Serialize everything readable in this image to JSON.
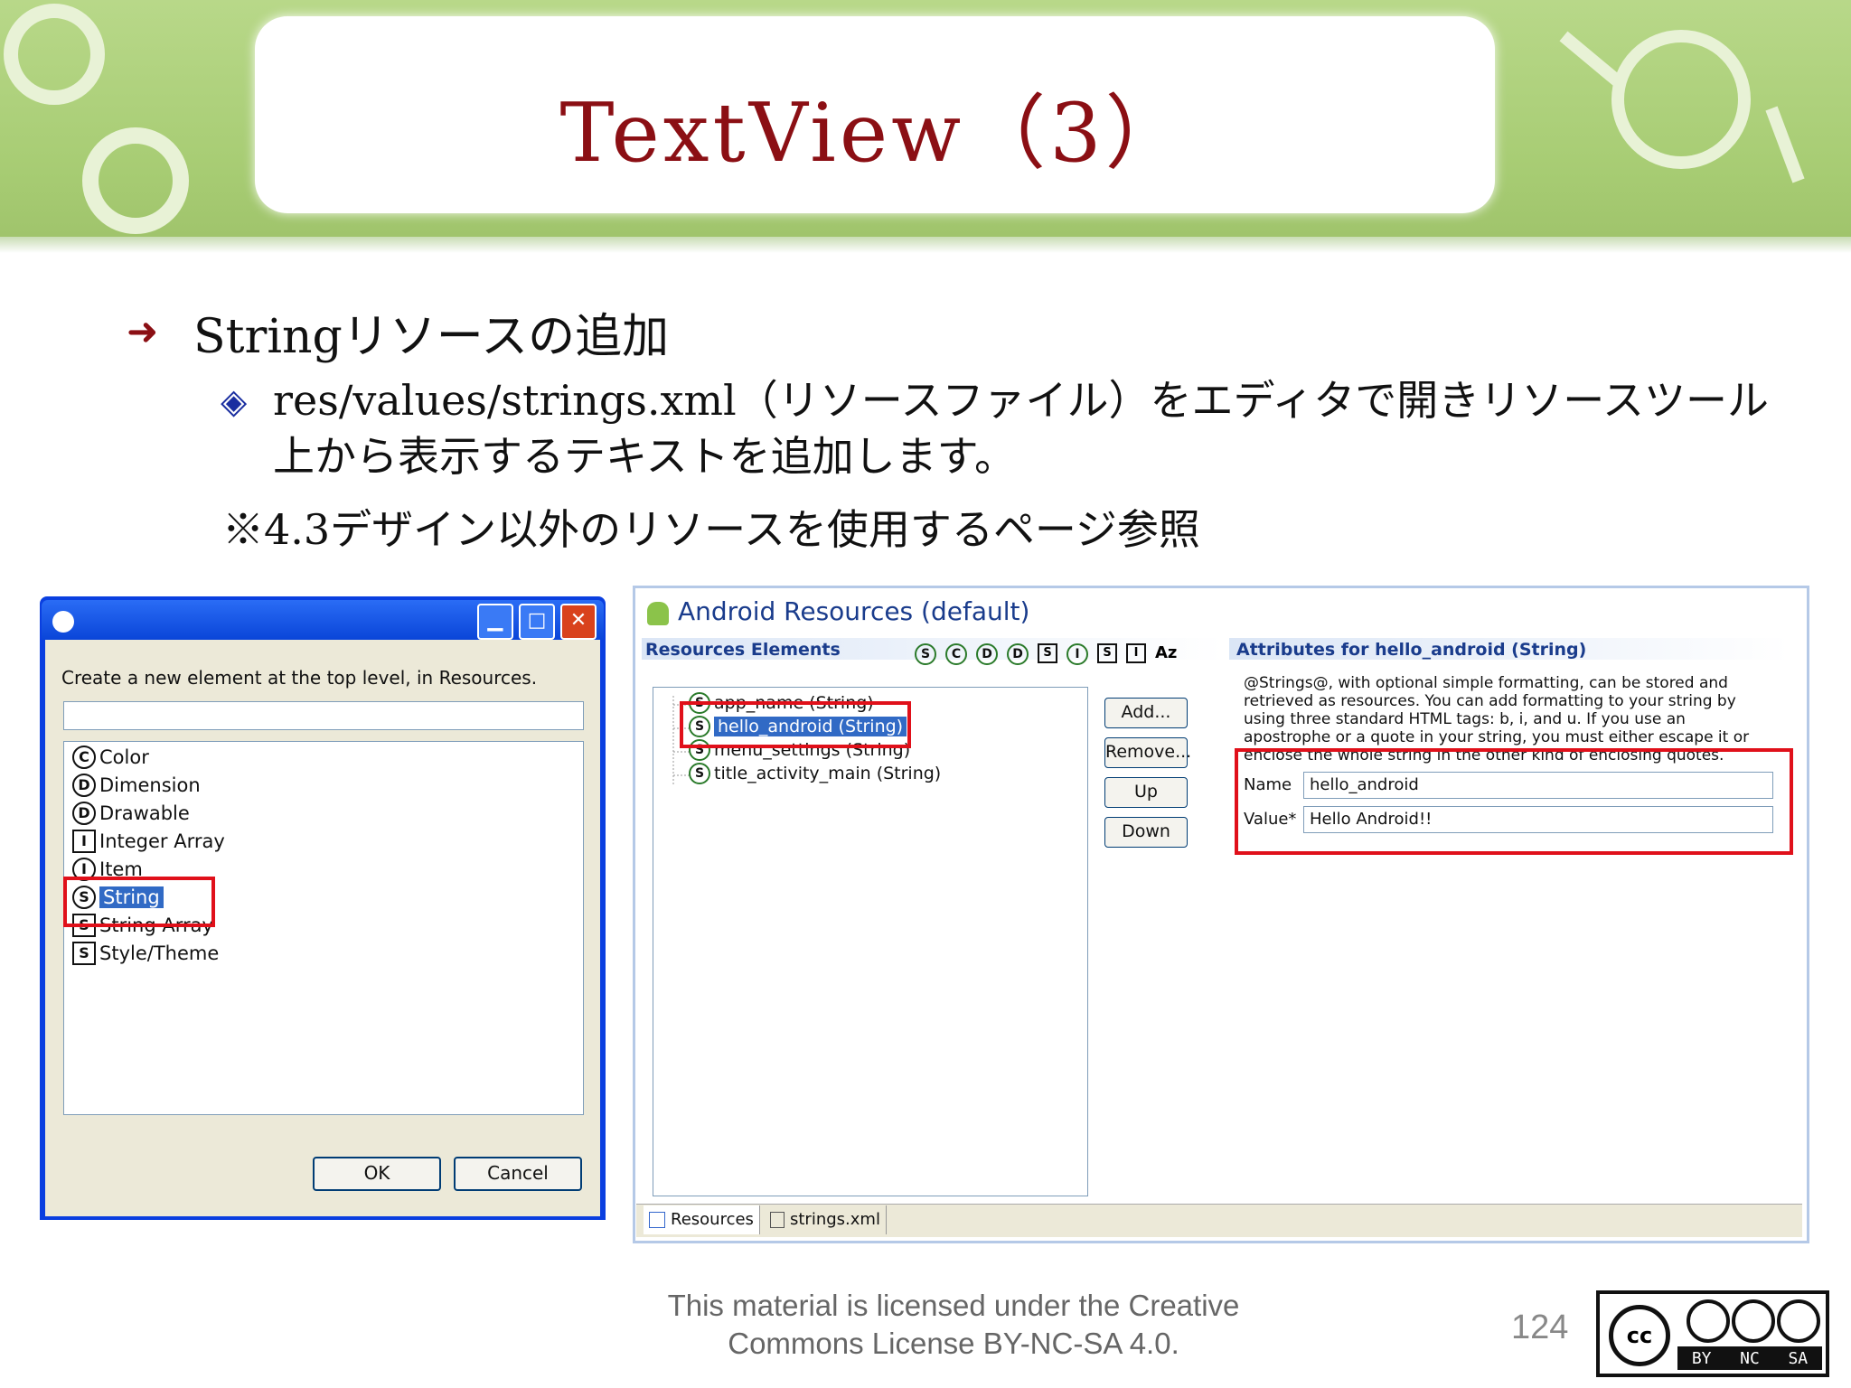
{
  "slide": {
    "title": "TextView（3）",
    "bullet1": "Stringリソースの追加",
    "bullet2": "res/values/strings.xml（リソースファイル）をエディタで開きリソースツール上から表示するテキストを追加します。",
    "note": "※4.3デザイン以外のリソースを使用するページ参照"
  },
  "dialog": {
    "prompt": "Create a new element at the top level, in Resources.",
    "input_value": "",
    "items": [
      {
        "icon": "C",
        "label": "Color"
      },
      {
        "icon": "D",
        "label": "Dimension"
      },
      {
        "icon": "D",
        "label": "Drawable"
      },
      {
        "icon": "I",
        "label": "Integer Array"
      },
      {
        "icon": "I",
        "label": "Item"
      },
      {
        "icon": "S",
        "label": "String"
      },
      {
        "icon": "S",
        "label": "String Array"
      },
      {
        "icon": "S",
        "label": "Style/Theme"
      }
    ],
    "ok_label": "OK",
    "cancel_label": "Cancel"
  },
  "editor": {
    "title": "Android Resources (default)",
    "elements_header": "Resources Elements",
    "toolbar_icons": [
      "S",
      "C",
      "D",
      "D",
      "S",
      "I",
      "S",
      "I",
      "Az"
    ],
    "tree": [
      "app_name (String)",
      "hello_android (String)",
      "menu_settings (String)",
      "title_activity_main (String)"
    ],
    "buttons": {
      "add": "Add...",
      "remove": "Remove...",
      "up": "Up",
      "down": "Down"
    },
    "attributes_header": "Attributes for hello_android (String)",
    "description": "@Strings@, with optional simple formatting, can be stored and retrieved as resources. You can add formatting to your string by using three standard HTML tags: b, i, and u. If you use an apostrophe or a quote in your string, you must either escape it or enclose the whole string in the other kind of enclosing quotes.",
    "name_label": "Name",
    "name_value": "hello_android",
    "value_label": "Value*",
    "value_value": "Hello Android!!",
    "tabs": [
      "Resources",
      "strings.xml"
    ]
  },
  "footer": {
    "license": "This material is licensed under the Creative Commons License BY-NC-SA 4.0.",
    "page": "124",
    "cc_labels": [
      "cc",
      "BY",
      "NC",
      "SA"
    ]
  },
  "colors": {
    "title": "#8b0f14",
    "highlight_box": "#e0101a",
    "banner": "#a7cc73"
  }
}
